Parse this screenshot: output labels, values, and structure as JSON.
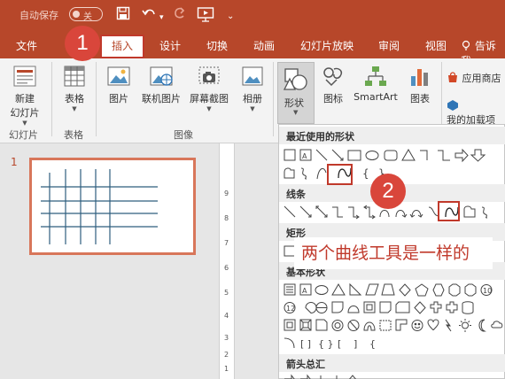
{
  "titlebar": {
    "autosave_label": "自动保存",
    "toggle_label": "关",
    "save_icon": "save-icon",
    "undo_icon": "undo-icon",
    "redo_icon": "redo-icon",
    "present_icon": "slideshow-icon",
    "customize_icon": "customize-icon"
  },
  "tabs": [
    {
      "label": "文件"
    },
    {
      "label": "插入"
    },
    {
      "label": "设计"
    },
    {
      "label": "切换"
    },
    {
      "label": "动画"
    },
    {
      "label": "幻灯片放映"
    },
    {
      "label": "审阅"
    },
    {
      "label": "视图"
    },
    {
      "label": "告诉我"
    }
  ],
  "ribbon": {
    "new_slide": "新建\n幻灯片",
    "new_slide_line1": "新建",
    "new_slide_line2": "幻灯片",
    "table": "表格",
    "picture": "图片",
    "online_picture": "联机图片",
    "screenshot": "屏幕截图",
    "album": "相册",
    "shapes": "形状",
    "icons": "图标",
    "smartart": "SmartArt",
    "chart": "图表",
    "store": "应用商店",
    "my_addins": "我的加载项",
    "groups": {
      "slides": "幻灯片",
      "tables": "表格",
      "images": "图像"
    }
  },
  "slide_pane": {
    "slide_number": "1"
  },
  "ruler": {
    "ticks": [
      "9",
      "8",
      "7",
      "6",
      "5",
      "4",
      "3",
      "2",
      "1"
    ]
  },
  "dropdown": {
    "recent_header": "最近使用的形状",
    "lines_header": "线条",
    "rect_header": "矩形",
    "basic_header": "基本形状",
    "arrows_header": "箭头总汇"
  },
  "callouts": {
    "badge1": "1",
    "badge2": "2",
    "annotation": "两个曲线工具是一样的"
  },
  "colors": {
    "brand": "#b7472a",
    "callout_red": "#d9463b",
    "annotation_text": "#c0392b",
    "slide_border": "#d8765a",
    "grid_lines": "#2e5e7e"
  }
}
